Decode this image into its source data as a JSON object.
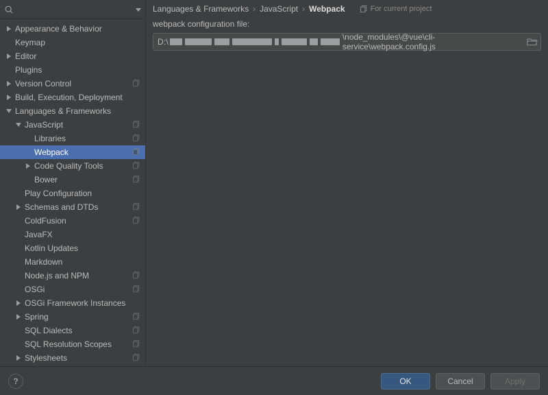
{
  "search": {
    "placeholder": ""
  },
  "breadcrumb": {
    "a": "Languages & Frameworks",
    "b": "JavaScript",
    "c": "Webpack"
  },
  "scope": "For current project",
  "field_label": "webpack configuration file:",
  "path": {
    "prefix": "D:\\",
    "suffix": "\\node_modules\\@vue\\cli-service\\webpack.config.js"
  },
  "tree": [
    {
      "label": "Appearance & Behavior",
      "indent": 0,
      "arrow": "right",
      "copy": false
    },
    {
      "label": "Keymap",
      "indent": 0,
      "arrow": "none",
      "copy": false
    },
    {
      "label": "Editor",
      "indent": 0,
      "arrow": "right",
      "copy": false
    },
    {
      "label": "Plugins",
      "indent": 0,
      "arrow": "none",
      "copy": false
    },
    {
      "label": "Version Control",
      "indent": 0,
      "arrow": "right",
      "copy": true
    },
    {
      "label": "Build, Execution, Deployment",
      "indent": 0,
      "arrow": "right",
      "copy": false
    },
    {
      "label": "Languages & Frameworks",
      "indent": 0,
      "arrow": "down",
      "copy": false
    },
    {
      "label": "JavaScript",
      "indent": 1,
      "arrow": "down",
      "copy": true
    },
    {
      "label": "Libraries",
      "indent": 2,
      "arrow": "none",
      "copy": true
    },
    {
      "label": "Webpack",
      "indent": 2,
      "arrow": "none",
      "copy": true,
      "selected": true
    },
    {
      "label": "Code Quality Tools",
      "indent": 2,
      "arrow": "right",
      "copy": true
    },
    {
      "label": "Bower",
      "indent": 2,
      "arrow": "none",
      "copy": true
    },
    {
      "label": "Play Configuration",
      "indent": 1,
      "arrow": "none",
      "copy": false
    },
    {
      "label": "Schemas and DTDs",
      "indent": 1,
      "arrow": "right",
      "copy": true
    },
    {
      "label": "ColdFusion",
      "indent": 1,
      "arrow": "none",
      "copy": true
    },
    {
      "label": "JavaFX",
      "indent": 1,
      "arrow": "none",
      "copy": false
    },
    {
      "label": "Kotlin Updates",
      "indent": 1,
      "arrow": "none",
      "copy": false
    },
    {
      "label": "Markdown",
      "indent": 1,
      "arrow": "none",
      "copy": false
    },
    {
      "label": "Node.js and NPM",
      "indent": 1,
      "arrow": "none",
      "copy": true
    },
    {
      "label": "OSGi",
      "indent": 1,
      "arrow": "none",
      "copy": true
    },
    {
      "label": "OSGi Framework Instances",
      "indent": 1,
      "arrow": "right",
      "copy": false
    },
    {
      "label": "Spring",
      "indent": 1,
      "arrow": "right",
      "copy": true
    },
    {
      "label": "SQL Dialects",
      "indent": 1,
      "arrow": "none",
      "copy": true
    },
    {
      "label": "SQL Resolution Scopes",
      "indent": 1,
      "arrow": "none",
      "copy": true
    },
    {
      "label": "Stylesheets",
      "indent": 1,
      "arrow": "right",
      "copy": true
    }
  ],
  "buttons": {
    "ok": "OK",
    "cancel": "Cancel",
    "apply": "Apply"
  }
}
